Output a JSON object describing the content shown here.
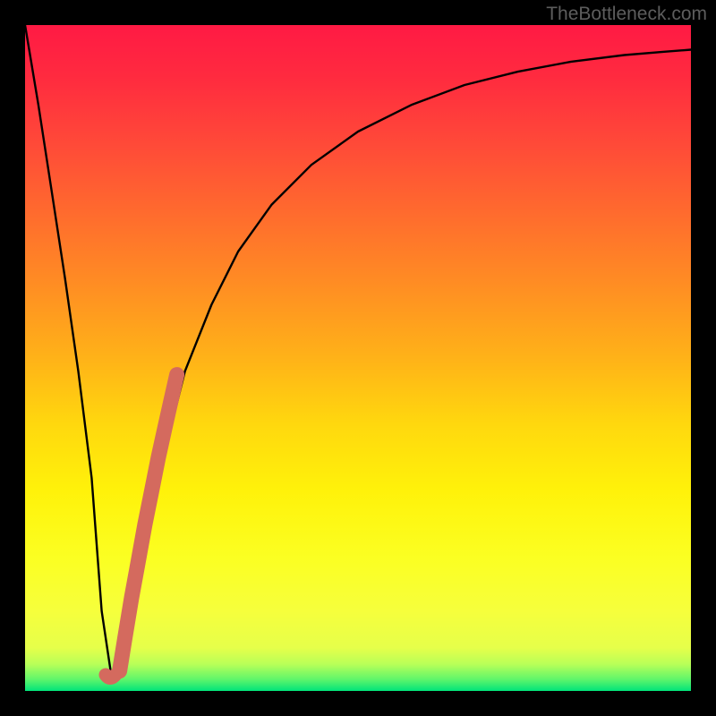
{
  "watermark": "TheBottleneck.com",
  "colors": {
    "page_bg": "#000000",
    "gradient_top": "#ff1a44",
    "gradient_mid": "#ffd80e",
    "gradient_bottom": "#00e47a",
    "curve": "#000000",
    "marker": "#d46a5e"
  },
  "chart_data": {
    "type": "line",
    "title": "",
    "xlabel": "",
    "ylabel": "",
    "xlim": [
      0,
      100
    ],
    "ylim": [
      0,
      100
    ],
    "series": [
      {
        "name": "bottleneck-curve",
        "x": [
          0,
          2,
          4,
          6,
          8,
          10,
          11.5,
          13,
          15,
          18,
          21,
          24,
          28,
          32,
          37,
          43,
          50,
          58,
          66,
          74,
          82,
          90,
          96,
          100
        ],
        "y": [
          100,
          88,
          75,
          62,
          48,
          32,
          12,
          2,
          8,
          22,
          36,
          48,
          58,
          66,
          73,
          79,
          84,
          88,
          91,
          93,
          94.5,
          95.5,
          96,
          96.3
        ]
      }
    ],
    "markers": [
      {
        "name": "highlight-segment",
        "x": [
          14.2,
          15.0,
          16.0,
          17.0,
          18.0,
          19.0,
          20.0,
          21.0,
          22.0,
          22.8
        ],
        "y": [
          3.0,
          8.0,
          14.0,
          19.5,
          25.0,
          30.0,
          35.0,
          39.5,
          44.0,
          47.5
        ]
      },
      {
        "name": "highlight-dot",
        "x": [
          13.1
        ],
        "y": [
          2.0
        ]
      }
    ]
  }
}
